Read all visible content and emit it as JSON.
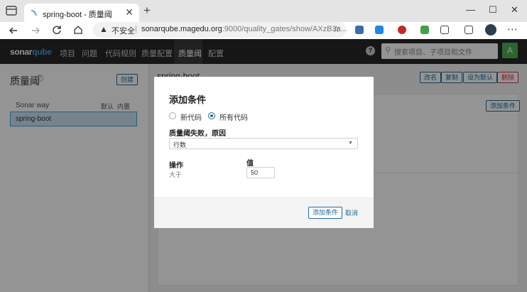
{
  "browser": {
    "tab_title": "spring-boot - 质量阈",
    "tab_close": "✕",
    "new_tab": "+",
    "url_warning": "不安全",
    "url_host": "sonarqube.magedu.org",
    "url_path": ":9000/quality_gates/show/AXzB3a...",
    "window_controls": [
      "—",
      "☐",
      "✕"
    ],
    "nav_icons": [
      "back-icon",
      "forward-icon",
      "refresh-icon",
      "home-icon"
    ]
  },
  "sonar": {
    "logo_a": "sonar",
    "logo_b": "qube",
    "menu": [
      "项目",
      "问题",
      "代码规则",
      "质量配置",
      "质量阈",
      "配置"
    ],
    "active_menu": "质量阈",
    "search_placeholder": "搜索项目、子项目和文件",
    "user_initial": "A",
    "help": "?"
  },
  "left": {
    "title": "质量阈",
    "create_button": "创建",
    "gate_head": "Sonar way",
    "col_default": "默认",
    "col_builtin": "内置",
    "selected_gate": "spring-boot"
  },
  "right": {
    "title": "spring-boot",
    "buttons": [
      "改名",
      "复制",
      "设为默认",
      "删除"
    ],
    "add_condition": "添加条件"
  },
  "modal": {
    "title": "添加条件",
    "radio_new": "新代码",
    "radio_all": "所有代码",
    "selected_radio": "所有代码",
    "metric_label": "质量阈失败，原因",
    "metric_value": "行数",
    "operator_label": "操作",
    "operator_value": "大于",
    "value_label": "值",
    "value_input": "50",
    "add_button": "添加条件",
    "cancel_link": "取消"
  }
}
